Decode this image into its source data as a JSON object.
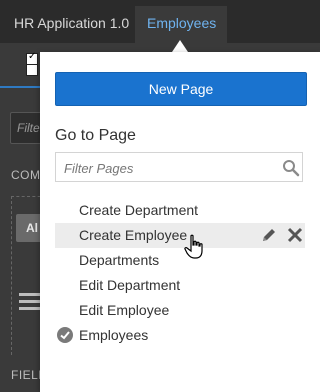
{
  "header": {
    "app_title": "HR Application 1.0",
    "current_page": "Employees"
  },
  "background": {
    "filter_placeholder": "Filte",
    "components_label": "COM",
    "align_button": "Al",
    "fields_label": "FIELD"
  },
  "popup": {
    "new_page_label": "New Page",
    "goto_title": "Go to Page",
    "filter_placeholder": "Filter Pages",
    "pages": [
      {
        "label": "Create Department"
      },
      {
        "label": "Create Employee"
      },
      {
        "label": "Departments"
      },
      {
        "label": "Edit Department"
      },
      {
        "label": "Edit Employee"
      },
      {
        "label": "Employees"
      }
    ],
    "hovered_page": "Create Employee",
    "current_page": "Employees"
  },
  "colors": {
    "accent": "#1a73cf",
    "crumb_link": "#6fb3ef",
    "check": "#7a7a7a"
  },
  "icons": {
    "search": "search-icon",
    "edit": "pencil-icon",
    "delete": "close-icon",
    "current": "check-circle-icon",
    "cursor": "hand-pointer-icon"
  }
}
